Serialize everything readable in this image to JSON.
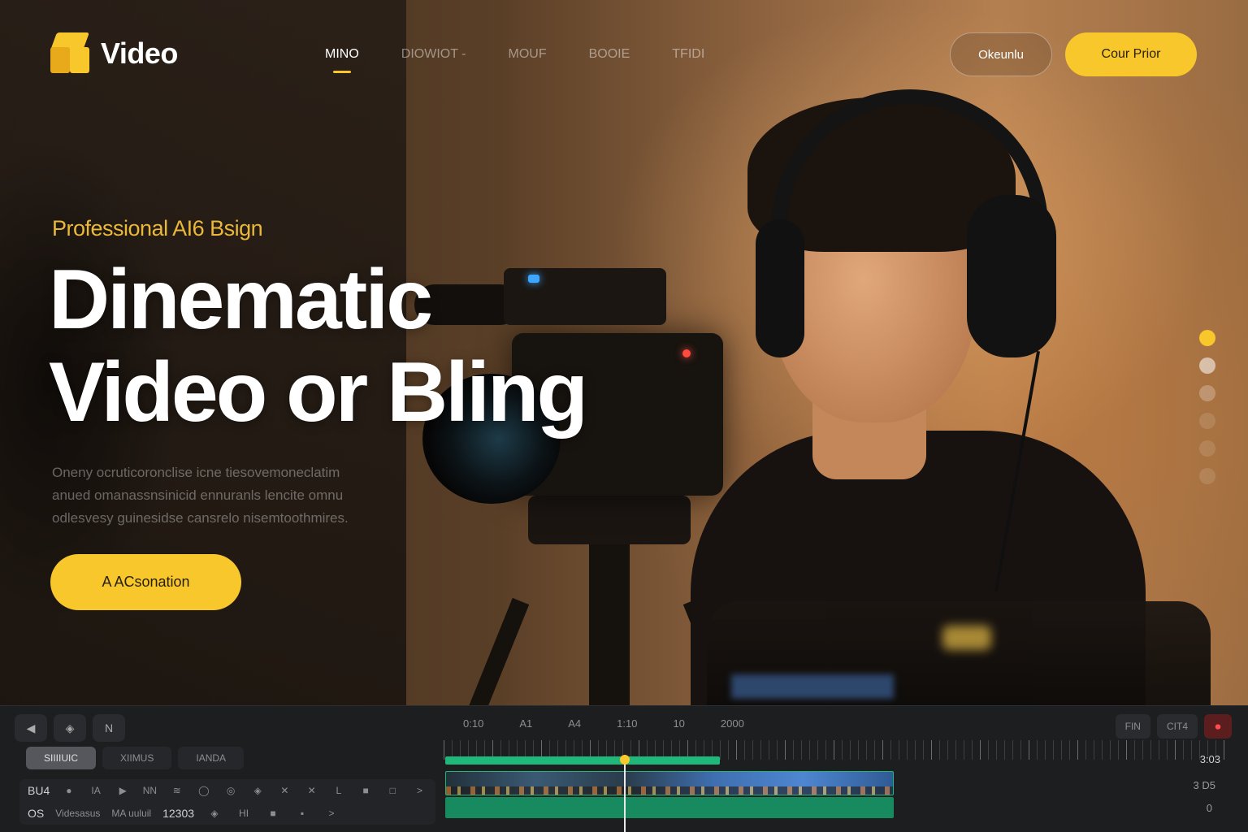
{
  "brand": {
    "name": "Video"
  },
  "nav": {
    "items": [
      {
        "label": "MINO",
        "active": true
      },
      {
        "label": "DIOWIOT -",
        "active": false
      },
      {
        "label": "MOUF",
        "active": false
      },
      {
        "label": "BOOIE",
        "active": false
      },
      {
        "label": "TFIDI",
        "active": false
      }
    ],
    "ghost_button": "Okeunlu",
    "cta_button": "Cour Prior"
  },
  "hero": {
    "eyebrow": "Professional AI6 Bsign",
    "headline_line1": "Dinematic",
    "headline_line2": "Video or Bling",
    "lede_lines": [
      "Oneny ocruticoronclise icne tiesovemoneclatim",
      "anued omanassnsinicid ennuranls lencite omnu",
      "odlesvesy guinesidse cansrelo nisemtoothmires."
    ],
    "button": "A ACsonation"
  },
  "slider_dots": {
    "count": 6,
    "active_index": 0
  },
  "editor": {
    "toolbar": [
      "◀",
      "◈",
      "N"
    ],
    "ruler_labels": [
      "0:10",
      "A1",
      "A4",
      "1:10",
      "10",
      "2000"
    ],
    "right_tools": [
      "FIN",
      "CIT4"
    ],
    "tabs": [
      {
        "label": "SIIIIUIC",
        "active": true
      },
      {
        "label": "XIIMUS",
        "active": false
      },
      {
        "label": "IANDA",
        "active": false
      }
    ],
    "track_row1": {
      "label": "BU4",
      "icons": [
        "●",
        "IA",
        "▶",
        "NN",
        "≋",
        "◯",
        "◎",
        "◈",
        "✕",
        "✕",
        "L",
        "■",
        "□",
        ">"
      ]
    },
    "track_row2": {
      "label": "OS",
      "clip_name": "Videsasus",
      "sub": "MA uuluil",
      "timecode": "12303",
      "icons": [
        "◈",
        "HI",
        "■",
        "▪",
        ">"
      ]
    },
    "right_time": "3:03",
    "right_track1": "3 D5",
    "right_track2": "0",
    "progress": 0.35,
    "playhead": 0.23,
    "colors": {
      "accent": "#f7c72c",
      "track_green": "#20b87a"
    }
  }
}
